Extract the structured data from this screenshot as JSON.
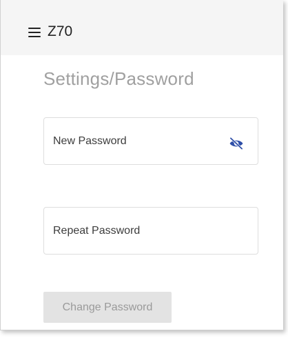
{
  "header": {
    "app_title": "Z70",
    "menu_icon": "hamburger-menu-icon"
  },
  "page": {
    "title": "Settings/Password"
  },
  "form": {
    "new_password": {
      "label": "New Password",
      "toggle_icon": "eye-off-icon",
      "toggle_icon_color": "#2f4fa8"
    },
    "repeat_password": {
      "label": "Repeat Password"
    },
    "submit": {
      "label": "Change Password",
      "state": "disabled"
    }
  }
}
